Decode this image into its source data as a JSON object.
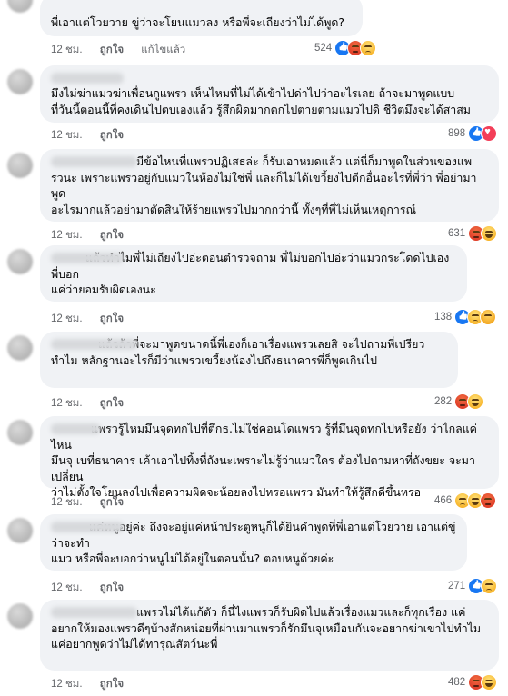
{
  "comments": [
    {
      "text": "พี่เอาแต่โวยวาย ขู่ว่าจะโยนแมวลง หรือพี่จะเถียงว่าไม่ได้พูด?",
      "time": "12 ชม.",
      "like_label": "ถูกใจ",
      "reply_label": "ตอบกลับ",
      "edited_label": "แก้ไขแล้ว",
      "reaction_count": "524",
      "reactions": [
        "like-icon",
        "angry-icon",
        "sad-icon"
      ]
    },
    {
      "text": "มึงไม่ฆ่าแมวฆ่าเพื่อนกูแพรว เห็นไหมที่ไม่ได้เข้าไปด่าไปว่าอะไรเลย ถ้าจะมาพูดแบบ\nที่วันนี้ตอนนี้ที่คงเดินไปตบเองแล้ว รู้สึกผิดมากตกไปตายตามแมวไปดิ ชีวิตมึงจะได้สาสม",
      "time": "12 ชม.",
      "like_label": "ถูกใจ",
      "reply_label": "ตอบกลับ",
      "reaction_count": "898",
      "reactions": [
        "like-icon",
        "heart-icon"
      ]
    },
    {
      "text": "มีข้อไหนที่แพรวปฏิเสธล่ะ ก็รับเอาหมดแล้ว แต่นี่ก็มาพูดในส่วนของแพ\nรวนะ เพราะแพรวอยู่กับแมวในห้องไม่ใช่พี่ และก็ไม่ได้เขวี้ยงไปตีกอื่นอะไรที่พี่ว่า พี่อย่ามาพูด\nอะไรมากแล้วอย่ามาตัดสินให้ร้ายแพรวไปมากกว่านี้ ทั้งๆที่พี่ไม่เห็นเหตุการณ์",
      "time": "12 ชม.",
      "like_label": "ถูกใจ",
      "reply_label": "ตอบกลับ",
      "reaction_count": "631",
      "reactions": [
        "angry-icon",
        "haha-icon"
      ]
    },
    {
      "text": "แล้วทำไมพี่ไม่เถียงไปอ่ะตอนตำรวจถาม พี่ไม่บอกไปอ่ะว่าแมวกระโดดไปเอง พี่บอก\nแค่ว่ายอมรับผิดเองนะ",
      "time": "12 ชม.",
      "like_label": "ถูกใจ",
      "reply_label": "ตอบกลับ",
      "reaction_count": "138",
      "reactions": [
        "like-icon",
        "sad-icon",
        "care-icon"
      ]
    },
    {
      "text": "แล้วถ้าพี่จะมาพูดขนาดนี้พี่เองก็เอาเรื่องแพรวเลยสิ จะไปถามพี่เปรียว\nทำไม หลักฐานอะไรก็มีว่าแพรวเขวี้ยงน้องไปถึงธนาคารพี่ก็พูดเกินไป",
      "time": "12 ชม.",
      "like_label": "ถูกใจ",
      "reply_label": "ตอบกลับ",
      "reaction_count": "282",
      "reactions": [
        "angry-icon",
        "haha-icon"
      ]
    },
    {
      "text": "แพรวรู้ไหมมึนจุดทกไปที่ตึกธ.ไม่ใช่คอนโดแพรว รู้ที่มึนจุดทกไปหรือยัง ว่าไกลแค่ไหน\nมึนจุ เบที่ธนาคาร เค้าเอาไปทิ้งที่ถังนะเพราะไม่รู้ว่าแมวใคร ต้องไปตามหาที่ถังขยะ จะมาเปลี่ยน\nว่าไม่ตั้งใจโยนลงไปเพื่อความผิดจะน้อยลงไปหรอแพรว มันทำให้รู้สึกดีขึ้นหรอ",
      "time": "12 ชม.",
      "like_label": "ถูกใจ",
      "reply_label": "ตอบกลับ",
      "reaction_count": "466",
      "reactions": [
        "sad-icon",
        "haha-icon",
        "angry-icon"
      ]
    },
    {
      "text": "แค่หนูอยู่ค่ะ ถึงจะอยู่แค่หน้าประตูหนูก็ได้ยินคำพูดที่พี่เอาแต่โวยวาย เอาแต่ขู่ว่าจะทำ\nแมว หรือพี่จะบอกว่าหนูไม่ได้อยู่ในตอนนั้น? ตอบหนูด้วยค่ะ",
      "time": "12 ชม.",
      "like_label": "ถูกใจ",
      "reply_label": "ตอบกลับ",
      "reaction_count": "271",
      "reactions": [
        "like-icon",
        "sad-icon"
      ]
    },
    {
      "text": "แพรวไม่ได้แก้ตัว ก็นี่ไงแพรวก็รับผิดไปแล้วเรื่องแมวและก็ทุกเรื่อง แค่\nอยากให้มองแพรวดีๆบ้างสักหน่อยที่ผ่านมาแพรวก็รักมึนจุเหมือนกันจะอยากฆ่าเขาไปทำไม\nแค่อยากพูดว่าไม่ได้ทารุณสัตว์นะพี่",
      "time": "12 ชม.",
      "like_label": "ถูกใจ",
      "reply_label": "ตอบกลับ",
      "reaction_count": "482",
      "reactions": [
        "angry-icon",
        "haha-icon"
      ]
    }
  ]
}
